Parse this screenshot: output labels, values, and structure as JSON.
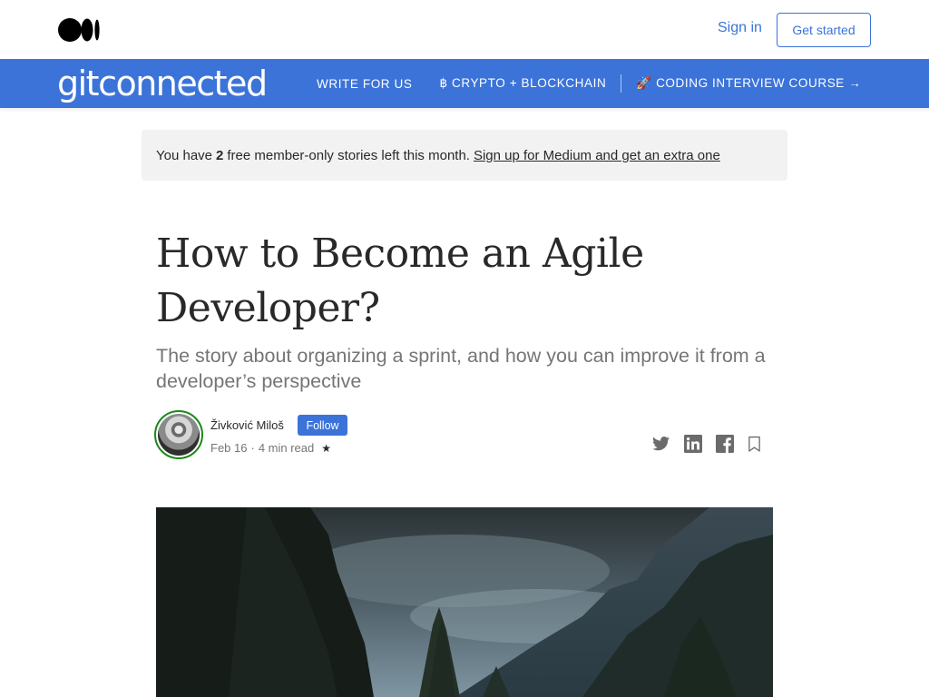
{
  "topbar": {
    "logo_icon": "medium-logo-icon",
    "signin_label": "Sign in",
    "getstarted_label": "Get started"
  },
  "publication": {
    "name": "gitconnected",
    "nav": [
      {
        "label": "WRITE FOR US"
      },
      {
        "label": "฿ CRYPTO + BLOCKCHAIN"
      },
      {
        "label": "🚀 CODING INTERVIEW COURSE →"
      }
    ],
    "brand_color": "#3b73d9"
  },
  "banner": {
    "pre": "You have",
    "count": "2",
    "post": "free member-only stories left this month.",
    "cta": "Sign up for Medium and get an extra one"
  },
  "article": {
    "title": "How to Become an Agile Developer?",
    "subtitle": "The story about organizing a sprint, and how you can improve it from a developer’s perspective",
    "author": "Živković Miloš",
    "follow_label": "Follow",
    "date": "Feb 16",
    "read_time": "4 min read",
    "star": "★",
    "share_icons": [
      "twitter-icon",
      "linkedin-icon",
      "facebook-icon",
      "bookmark-icon"
    ],
    "hero_image": "misty mountain forest"
  }
}
